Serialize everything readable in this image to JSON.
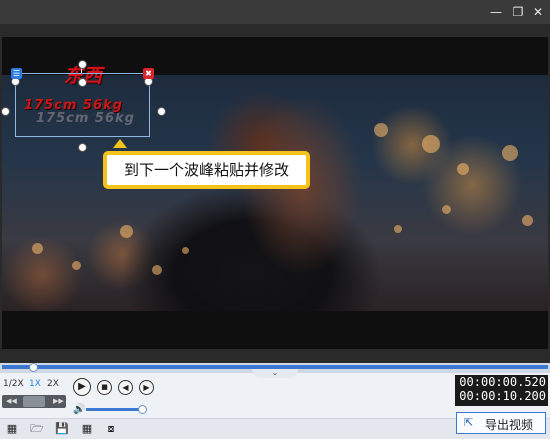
{
  "window": {
    "min_icon": "minimize-icon",
    "restore_icon": "restore-icon",
    "close_icon": "close-icon"
  },
  "overlay": {
    "title_text": "东西",
    "subtitle_text": "175cm 56kg",
    "ghost_text": "175cm 56kg",
    "edit_icon": "list-icon",
    "delete_icon": "delete-icon"
  },
  "tooltip": {
    "text": "到下一个波峰粘贴并修改"
  },
  "playback": {
    "speeds": [
      "1/2X",
      "1X",
      "2X"
    ],
    "active_speed": "1X",
    "timeline_progress": 0.05,
    "volume_level": 1.0
  },
  "timecode": {
    "current": "00:00:00.520",
    "total": "00:00:10.200"
  },
  "toolbar": {
    "icons": [
      "new-project-icon",
      "open-folder-icon",
      "save-icon",
      "save-as-icon",
      "share-icon"
    ]
  },
  "export": {
    "label": "导出视频",
    "icon": "export-icon"
  },
  "colors": {
    "accent": "#3b78d2",
    "tooltip_border": "#f5c21b",
    "title_red": "#d8121a"
  }
}
